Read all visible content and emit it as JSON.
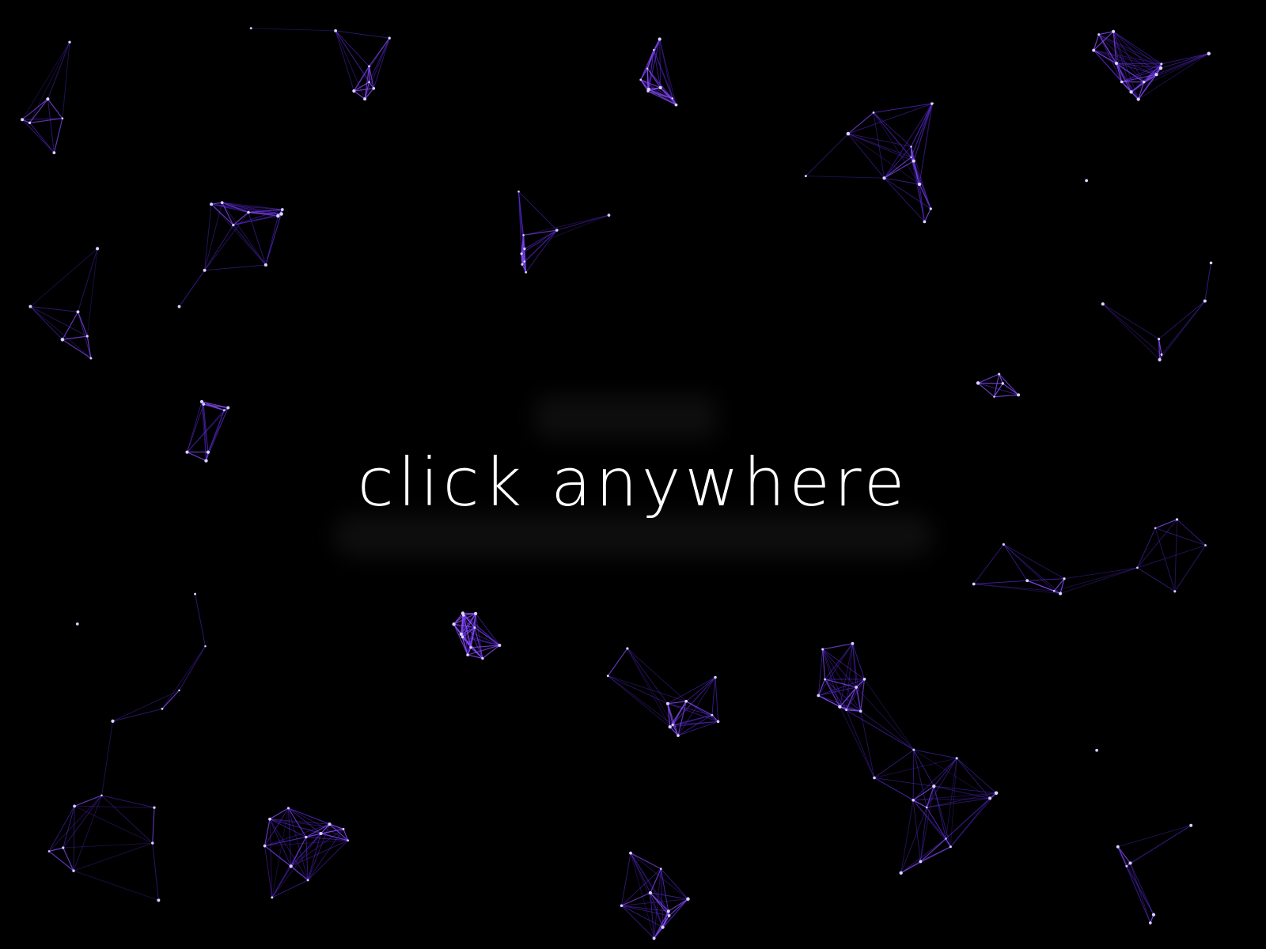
{
  "stage": {
    "prompt_text": "click anywhere",
    "background_color": "#000000",
    "text_color": "#ffffff"
  },
  "network": {
    "node_color": "#d8d4ff",
    "line_color": "#5b2bd8",
    "line_color_bright": "#8a4dff"
  }
}
